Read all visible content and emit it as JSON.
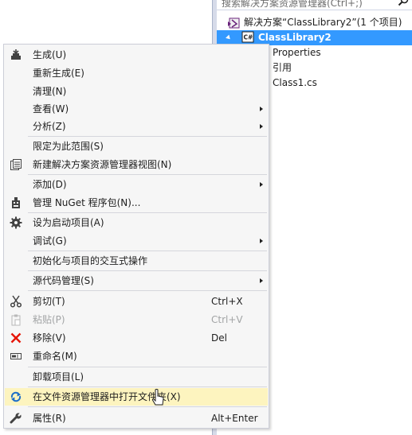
{
  "solution_explorer": {
    "search_placeholder": "搜索解决方案资源管理器(Ctrl+;)",
    "tree": [
      {
        "label": "解决方案“ClassLibrary2”(1 个项目)",
        "icon": "solution-icon",
        "selected": false
      },
      {
        "label": "ClassLibrary2",
        "icon": "csharp-project-icon",
        "selected": true
      },
      {
        "label": "Properties",
        "icon": "properties-icon",
        "selected": false
      },
      {
        "label": "引用",
        "icon": "references-icon",
        "selected": false
      },
      {
        "label": "Class1.cs",
        "icon": "cs-file-icon",
        "selected": false
      }
    ]
  },
  "context_menu": {
    "items": [
      {
        "label": "生成(U)",
        "icon": "build-icon"
      },
      {
        "label": "重新生成(E)"
      },
      {
        "label": "清理(N)"
      },
      {
        "label": "查看(W)",
        "submenu": true
      },
      {
        "label": "分析(Z)",
        "submenu": true
      },
      {
        "label": "限定为此范围(S)"
      },
      {
        "label": "新建解决方案资源管理器视图(N)",
        "icon": "new-view-icon"
      },
      {
        "label": "添加(D)",
        "submenu": true
      },
      {
        "label": "管理 NuGet 程序包(N)...",
        "icon": "nuget-icon"
      },
      {
        "label": "设为启动项目(A)",
        "icon": "gear-icon"
      },
      {
        "label": "调试(G)",
        "submenu": true
      },
      {
        "label": "初始化与项目的交互式操作"
      },
      {
        "label": "源代码管理(S)",
        "submenu": true
      },
      {
        "label": "剪切(T)",
        "shortcut": "Ctrl+X",
        "icon": "scissors-icon"
      },
      {
        "label": "粘贴(P)",
        "shortcut": "Ctrl+V",
        "icon": "paste-icon",
        "disabled": true
      },
      {
        "label": "移除(V)",
        "shortcut": "Del",
        "icon": "remove-x-icon"
      },
      {
        "label": "重命名(M)",
        "icon": "rename-icon"
      },
      {
        "label": "卸载项目(L)"
      },
      {
        "label": "在文件资源管理器中打开文件夹(X)",
        "icon": "open-folder-arrow-icon",
        "highlighted": true
      },
      {
        "label": "属性(R)",
        "shortcut": "Alt+Enter",
        "icon": "wrench-icon"
      }
    ]
  },
  "colors": {
    "selection": "#3399ff",
    "menu_background": "#f6f6f6",
    "hover_highlight": "#fdf4bf",
    "remove_red": "#e51400"
  }
}
